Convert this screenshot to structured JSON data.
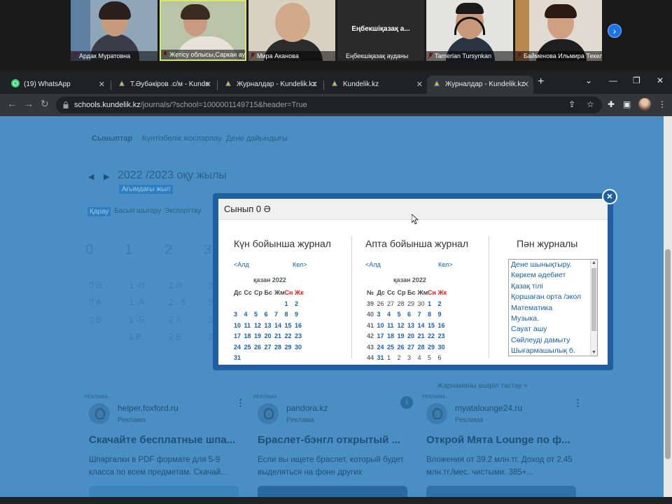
{
  "video_call": {
    "participants": [
      {
        "name": "Ардак Муратовна"
      },
      {
        "name": "Жетісу облысы,Саркан ауданы"
      },
      {
        "name": "Мира Аканова"
      },
      {
        "name": "Еңбекшіқазақ ауданы",
        "center_label": "Еңбекшіқазақ а..."
      },
      {
        "name": "Tamerlan Tursynkan"
      },
      {
        "name": "Байменова Ильмира Текели"
      }
    ]
  },
  "browser": {
    "tabs": [
      {
        "label": "(19) WhatsApp"
      },
      {
        "label": "Т.Әубәкіров .с/м - Kunde"
      },
      {
        "label": "Журналдар - Kundelik.kz"
      },
      {
        "label": "Kundelik.kz"
      },
      {
        "label": "Журналдар - Kundelik.kz"
      }
    ],
    "url_host": "schools.kundelik.kz",
    "url_path": "/journals/?school=1000001149715&header=True"
  },
  "page": {
    "subnav": [
      "Сыныптар",
      "Күнтізбелік жоспарлау",
      "Дене дайындығы"
    ],
    "year": {
      "title": "2022 /2023 оқу жылы",
      "badge": "Ағымдағы жыл"
    },
    "view_buttons": [
      "Қарау",
      "Басып шығару",
      "Экспорттау"
    ],
    "grades": [
      "0",
      "1",
      "2",
      "3"
    ],
    "classes": [
      [
        "0 Ә",
        "1 -Ә",
        "2 Ә",
        "3"
      ],
      [
        "0 А",
        "1 -А",
        "2 - б",
        "3"
      ],
      [
        "0 В",
        "1 -Б",
        "2 А",
        "3"
      ],
      [
        "",
        "1 В",
        "2 В",
        "3"
      ]
    ]
  },
  "modal": {
    "title": "Сынып 0 Ә",
    "close_label": "×",
    "daily": {
      "title": "Күн бойынша журнал",
      "prev": "<Алд",
      "next": "Кел>",
      "month": "қазан 2022",
      "weekdays": [
        "Дс",
        "Сс",
        "Ср",
        "Бс",
        "Жм",
        "Сн",
        "Жк"
      ],
      "weeks": [
        [
          "",
          "",
          "",
          "",
          "",
          "1",
          "2"
        ],
        [
          "3",
          "4",
          "5",
          "6",
          "7",
          "8",
          "9"
        ],
        [
          "10",
          "11",
          "12",
          "13",
          "14",
          "15",
          "16"
        ],
        [
          "17",
          "18",
          "19",
          "20",
          "21",
          "22",
          "23"
        ],
        [
          "24",
          "25",
          "26",
          "27",
          "28",
          "29",
          "30"
        ],
        [
          "31",
          "",
          "",
          "",
          "",
          "",
          ""
        ]
      ]
    },
    "weekly": {
      "title": "Апта бойынша журнал",
      "prev": "<Алд",
      "next": "Кел>",
      "month": "қазан 2022",
      "week_col": "№",
      "weekdays": [
        "Дс",
        "Сс",
        "Ср",
        "Бс",
        "Жм",
        "Сн",
        "Жк"
      ],
      "weeks": [
        {
          "no": "39",
          "days": [
            "26",
            "27",
            "28",
            "29",
            "30",
            "1",
            "2"
          ]
        },
        {
          "no": "40",
          "days": [
            "3",
            "4",
            "5",
            "6",
            "7",
            "8",
            "9"
          ]
        },
        {
          "no": "41",
          "days": [
            "10",
            "11",
            "12",
            "13",
            "14",
            "15",
            "16"
          ]
        },
        {
          "no": "42",
          "days": [
            "17",
            "18",
            "19",
            "20",
            "21",
            "22",
            "23"
          ]
        },
        {
          "no": "43",
          "days": [
            "24",
            "25",
            "26",
            "27",
            "28",
            "29",
            "30"
          ]
        },
        {
          "no": "44",
          "days": [
            "31",
            "1",
            "2",
            "3",
            "4",
            "5",
            "6"
          ]
        }
      ]
    },
    "subjects": {
      "title": "Пән журналы",
      "items": [
        "Дене шынықтыру.",
        "Көркем әдебиет",
        "Қазақ тілі",
        "Қоршаған орта /экол",
        "Математика",
        "Музыка.",
        "Сауат ашу",
        "Сөйлеуді дамыту",
        "Шығармашылық б."
      ]
    }
  },
  "ads": {
    "hide_label": "Жарнаманы өшіріп тастау ×",
    "items": [
      {
        "tag": "РЕКЛАМА",
        "domain": "helper.foxford.ru",
        "sub": "Реклама",
        "title": "Скачайте бесплатные шпа...",
        "desc": "Шпаргалки в PDF формате для 5-9 класса по всем предметам. Скачай..."
      },
      {
        "tag": "РЕКЛАМА",
        "domain": "pandora.kz",
        "sub": "Реклама",
        "title": "Браслет-бэнгл открытый ...",
        "desc": "Если вы ищете браслет, который будет выделяться на фоне других"
      },
      {
        "tag": "РЕКЛАМА",
        "domain": "myatalounge24.ru",
        "sub": "Реклама",
        "title": "Открой Мята Lounge по ф...",
        "desc": "Вложения от 39.2 млн.тг. Доход от 2.45 млн.тг./мес. чистыми. 385+..."
      }
    ]
  }
}
